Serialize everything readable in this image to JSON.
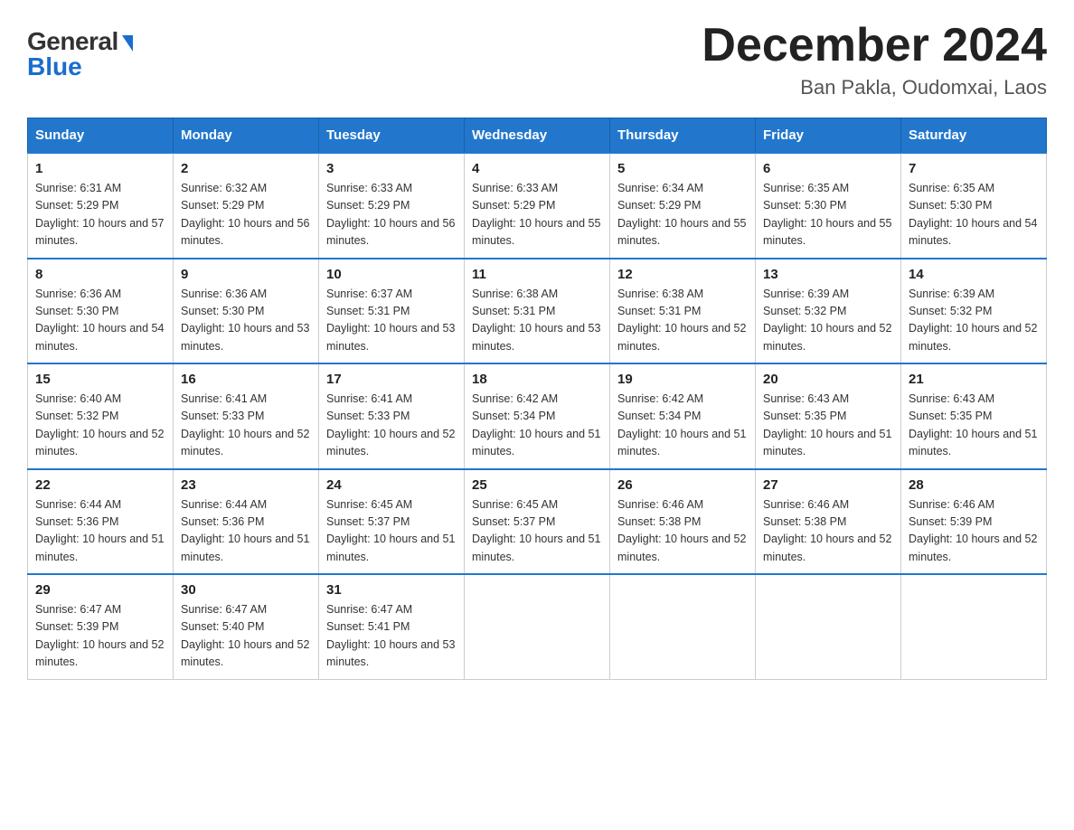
{
  "header": {
    "logo": {
      "general": "General",
      "blue": "Blue"
    },
    "title": "December 2024",
    "subtitle": "Ban Pakla, Oudomxai, Laos"
  },
  "days_of_week": [
    "Sunday",
    "Monday",
    "Tuesday",
    "Wednesday",
    "Thursday",
    "Friday",
    "Saturday"
  ],
  "weeks": [
    [
      {
        "day": "1",
        "sunrise": "6:31 AM",
        "sunset": "5:29 PM",
        "daylight": "10 hours and 57 minutes."
      },
      {
        "day": "2",
        "sunrise": "6:32 AM",
        "sunset": "5:29 PM",
        "daylight": "10 hours and 56 minutes."
      },
      {
        "day": "3",
        "sunrise": "6:33 AM",
        "sunset": "5:29 PM",
        "daylight": "10 hours and 56 minutes."
      },
      {
        "day": "4",
        "sunrise": "6:33 AM",
        "sunset": "5:29 PM",
        "daylight": "10 hours and 55 minutes."
      },
      {
        "day": "5",
        "sunrise": "6:34 AM",
        "sunset": "5:29 PM",
        "daylight": "10 hours and 55 minutes."
      },
      {
        "day": "6",
        "sunrise": "6:35 AM",
        "sunset": "5:30 PM",
        "daylight": "10 hours and 55 minutes."
      },
      {
        "day": "7",
        "sunrise": "6:35 AM",
        "sunset": "5:30 PM",
        "daylight": "10 hours and 54 minutes."
      }
    ],
    [
      {
        "day": "8",
        "sunrise": "6:36 AM",
        "sunset": "5:30 PM",
        "daylight": "10 hours and 54 minutes."
      },
      {
        "day": "9",
        "sunrise": "6:36 AM",
        "sunset": "5:30 PM",
        "daylight": "10 hours and 53 minutes."
      },
      {
        "day": "10",
        "sunrise": "6:37 AM",
        "sunset": "5:31 PM",
        "daylight": "10 hours and 53 minutes."
      },
      {
        "day": "11",
        "sunrise": "6:38 AM",
        "sunset": "5:31 PM",
        "daylight": "10 hours and 53 minutes."
      },
      {
        "day": "12",
        "sunrise": "6:38 AM",
        "sunset": "5:31 PM",
        "daylight": "10 hours and 52 minutes."
      },
      {
        "day": "13",
        "sunrise": "6:39 AM",
        "sunset": "5:32 PM",
        "daylight": "10 hours and 52 minutes."
      },
      {
        "day": "14",
        "sunrise": "6:39 AM",
        "sunset": "5:32 PM",
        "daylight": "10 hours and 52 minutes."
      }
    ],
    [
      {
        "day": "15",
        "sunrise": "6:40 AM",
        "sunset": "5:32 PM",
        "daylight": "10 hours and 52 minutes."
      },
      {
        "day": "16",
        "sunrise": "6:41 AM",
        "sunset": "5:33 PM",
        "daylight": "10 hours and 52 minutes."
      },
      {
        "day": "17",
        "sunrise": "6:41 AM",
        "sunset": "5:33 PM",
        "daylight": "10 hours and 52 minutes."
      },
      {
        "day": "18",
        "sunrise": "6:42 AM",
        "sunset": "5:34 PM",
        "daylight": "10 hours and 51 minutes."
      },
      {
        "day": "19",
        "sunrise": "6:42 AM",
        "sunset": "5:34 PM",
        "daylight": "10 hours and 51 minutes."
      },
      {
        "day": "20",
        "sunrise": "6:43 AM",
        "sunset": "5:35 PM",
        "daylight": "10 hours and 51 minutes."
      },
      {
        "day": "21",
        "sunrise": "6:43 AM",
        "sunset": "5:35 PM",
        "daylight": "10 hours and 51 minutes."
      }
    ],
    [
      {
        "day": "22",
        "sunrise": "6:44 AM",
        "sunset": "5:36 PM",
        "daylight": "10 hours and 51 minutes."
      },
      {
        "day": "23",
        "sunrise": "6:44 AM",
        "sunset": "5:36 PM",
        "daylight": "10 hours and 51 minutes."
      },
      {
        "day": "24",
        "sunrise": "6:45 AM",
        "sunset": "5:37 PM",
        "daylight": "10 hours and 51 minutes."
      },
      {
        "day": "25",
        "sunrise": "6:45 AM",
        "sunset": "5:37 PM",
        "daylight": "10 hours and 51 minutes."
      },
      {
        "day": "26",
        "sunrise": "6:46 AM",
        "sunset": "5:38 PM",
        "daylight": "10 hours and 52 minutes."
      },
      {
        "day": "27",
        "sunrise": "6:46 AM",
        "sunset": "5:38 PM",
        "daylight": "10 hours and 52 minutes."
      },
      {
        "day": "28",
        "sunrise": "6:46 AM",
        "sunset": "5:39 PM",
        "daylight": "10 hours and 52 minutes."
      }
    ],
    [
      {
        "day": "29",
        "sunrise": "6:47 AM",
        "sunset": "5:39 PM",
        "daylight": "10 hours and 52 minutes."
      },
      {
        "day": "30",
        "sunrise": "6:47 AM",
        "sunset": "5:40 PM",
        "daylight": "10 hours and 52 minutes."
      },
      {
        "day": "31",
        "sunrise": "6:47 AM",
        "sunset": "5:41 PM",
        "daylight": "10 hours and 53 minutes."
      },
      null,
      null,
      null,
      null
    ]
  ]
}
